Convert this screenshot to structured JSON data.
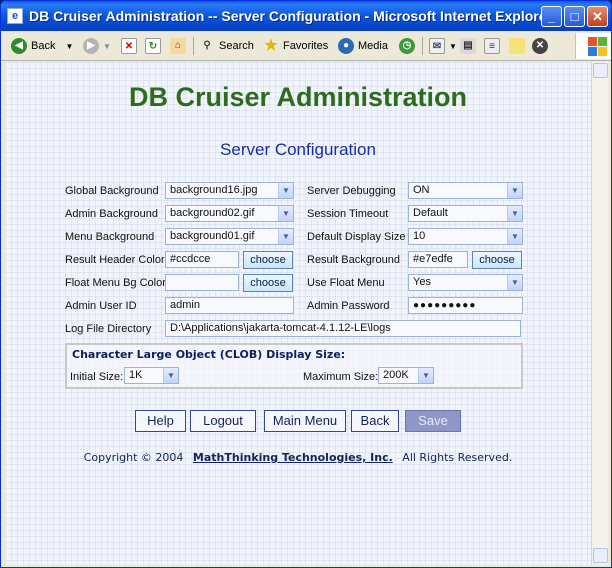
{
  "window": {
    "title": "DB Cruiser Administration -- Server Configuration - Microsoft Internet Explorer",
    "minimize": "_",
    "maximize": "□",
    "close": "✕"
  },
  "toolbar": {
    "back": "Back",
    "search": "Search",
    "favorites": "Favorites",
    "media": "Media"
  },
  "page": {
    "heading": "DB Cruiser Administration",
    "subheading": "Server Configuration"
  },
  "fields": {
    "global_background": {
      "label": "Global Background",
      "value": "background16.jpg"
    },
    "admin_background": {
      "label": "Admin Background",
      "value": "background02.gif"
    },
    "menu_background": {
      "label": "Menu Background",
      "value": "background01.gif"
    },
    "result_header_color": {
      "label": "Result Header Color",
      "value": "#ccdcce",
      "button": "choose"
    },
    "float_menu_bg_color": {
      "label": "Float Menu Bg Color",
      "value": "",
      "button": "choose"
    },
    "admin_user_id": {
      "label": "Admin User ID",
      "value": "admin"
    },
    "server_debugging": {
      "label": "Server Debugging",
      "value": "ON"
    },
    "session_timeout": {
      "label": "Session Timeout",
      "value": "Default"
    },
    "default_display_size": {
      "label": "Default Display Size",
      "value": "10"
    },
    "result_background": {
      "label": "Result Background",
      "value": "#e7edfe",
      "button": "choose"
    },
    "use_float_menu": {
      "label": "Use Float Menu",
      "value": "Yes"
    },
    "admin_password": {
      "label": "Admin Password",
      "value": "●●●●●●●●●"
    },
    "log_file_directory": {
      "label": "Log File Directory",
      "value": "D:\\Applications\\jakarta-tomcat-4.1.12-LE\\logs"
    }
  },
  "clob": {
    "title": "Character Large Object (CLOB) Display Size:",
    "initial_label": "Initial Size:",
    "initial_value": "1K",
    "maximum_label": "Maximum Size:",
    "maximum_value": "200K"
  },
  "buttons": {
    "help": "Help",
    "logout": "Logout",
    "main_menu": "Main Menu",
    "back": "Back",
    "save": "Save"
  },
  "footer": {
    "copyright": "Copyright © 2004",
    "company": "MathThinking Technologies, Inc.",
    "rights": "All Rights Reserved."
  },
  "colors": {
    "heading": "#2e6b1c",
    "subheading": "#1a2ca0",
    "button_border": "#34498c",
    "save_disabled": "#8e97c6"
  }
}
